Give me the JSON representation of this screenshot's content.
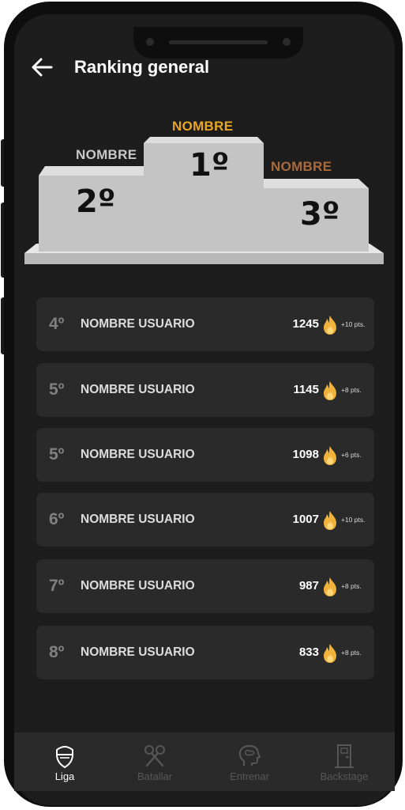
{
  "header": {
    "title": "Ranking general"
  },
  "podium": {
    "first": {
      "name": "NOMBRE",
      "rank": "1º",
      "name_color": "#e8a623"
    },
    "second": {
      "name": "NOMBRE",
      "rank": "2º",
      "name_color": "#c8c8c8"
    },
    "third": {
      "name": "NOMBRE",
      "rank": "3º",
      "name_color": "#a86a3c"
    }
  },
  "ranking": [
    {
      "rank": "4º",
      "name": "NOMBRE USUARIO",
      "score": "1245",
      "delta": "+10 pts."
    },
    {
      "rank": "5º",
      "name": "NOMBRE USUARIO",
      "score": "1145",
      "delta": "+8 pts."
    },
    {
      "rank": "5º",
      "name": "NOMBRE USUARIO",
      "score": "1098",
      "delta": "+6 pts."
    },
    {
      "rank": "6º",
      "name": "NOMBRE USUARIO",
      "score": "1007",
      "delta": "+10 pts."
    },
    {
      "rank": "7º",
      "name": "NOMBRE USUARIO",
      "score": "987",
      "delta": "+8 pts."
    },
    {
      "rank": "8º",
      "name": "NOMBRE USUARIO",
      "score": "833",
      "delta": "+8 pts."
    }
  ],
  "tabs": [
    {
      "label": "Liga",
      "icon": "shield-icon",
      "active": true
    },
    {
      "label": "Batallar",
      "icon": "crossed-microphones-icon",
      "active": false
    },
    {
      "label": "Entrenar",
      "icon": "brain-head-icon",
      "active": false
    },
    {
      "label": "Backstage",
      "icon": "door-icon",
      "active": false
    }
  ],
  "colors": {
    "background": "#1d1d1d",
    "card": "#2a2a2a",
    "podium": "#c4c4c4",
    "gold": "#e8a623",
    "bronze": "#a86a3c",
    "flame": "#f0b23a"
  }
}
